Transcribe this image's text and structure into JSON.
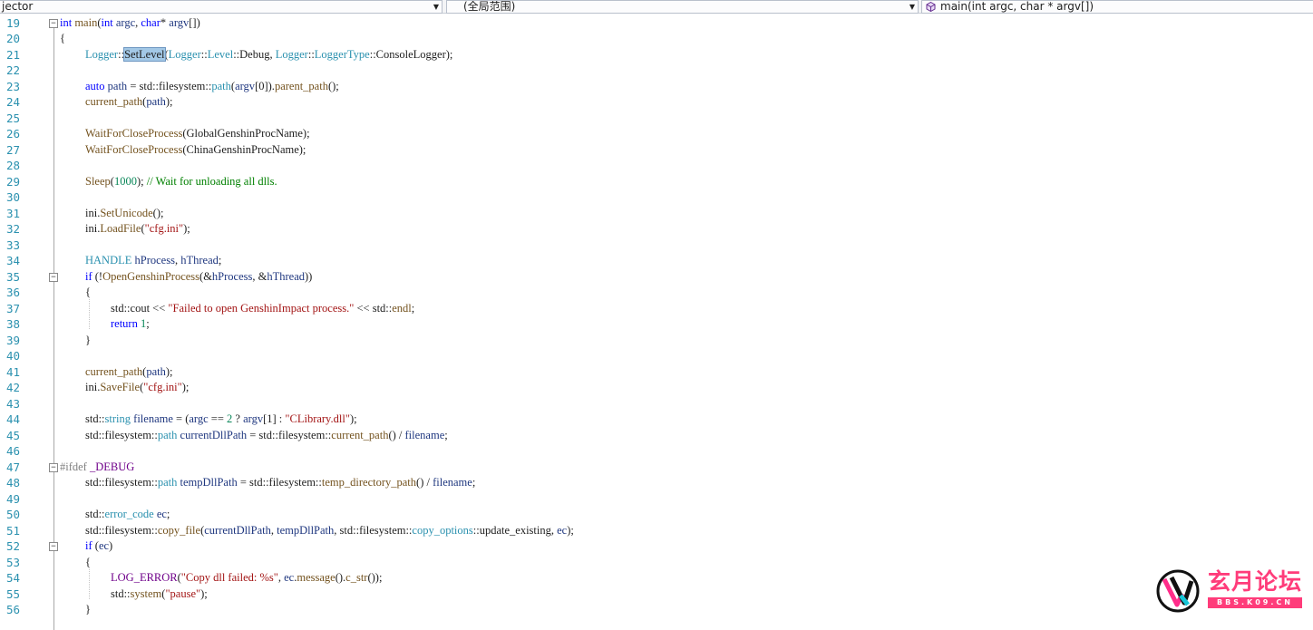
{
  "navbar": {
    "project": "jector",
    "scope": "(全局范围)",
    "member": "main(int argc, char * argv[])"
  },
  "editor": {
    "lines": [
      {
        "n": "19",
        "fold": "minus",
        "indent": 0,
        "toks": [
          [
            "kw",
            "int"
          ],
          [
            "p",
            " "
          ],
          [
            "fn",
            "main"
          ],
          [
            "p",
            "("
          ],
          [
            "kw",
            "int"
          ],
          [
            "p",
            " "
          ],
          [
            "var",
            "argc"
          ],
          [
            "p",
            ", "
          ],
          [
            "kw",
            "char"
          ],
          [
            "p",
            "* "
          ],
          [
            "var",
            "argv"
          ],
          [
            "p",
            "[])"
          ]
        ]
      },
      {
        "n": "20",
        "indent": 0,
        "toks": [
          [
            "p",
            "{"
          ]
        ]
      },
      {
        "n": "21",
        "indent": 1,
        "toks": [
          [
            "type",
            "Logger"
          ],
          [
            "p",
            "::"
          ],
          [
            "hl",
            "SetLevel"
          ],
          [
            "p",
            "("
          ],
          [
            "type",
            "Logger"
          ],
          [
            "p",
            "::"
          ],
          [
            "type",
            "Level"
          ],
          [
            "p",
            "::Debug, "
          ],
          [
            "type",
            "Logger"
          ],
          [
            "p",
            "::"
          ],
          [
            "type",
            "LoggerType"
          ],
          [
            "p",
            "::ConsoleLogger);"
          ]
        ]
      },
      {
        "n": "22",
        "indent": 1,
        "toks": []
      },
      {
        "n": "23",
        "indent": 1,
        "toks": [
          [
            "kw",
            "auto"
          ],
          [
            "p",
            " "
          ],
          [
            "var",
            "path"
          ],
          [
            "p",
            " = std::filesystem::"
          ],
          [
            "type",
            "path"
          ],
          [
            "p",
            "("
          ],
          [
            "var",
            "argv"
          ],
          [
            "p",
            "[0])."
          ],
          [
            "fn",
            "parent_path"
          ],
          [
            "p",
            "();"
          ]
        ]
      },
      {
        "n": "24",
        "indent": 1,
        "toks": [
          [
            "fn",
            "current_path"
          ],
          [
            "p",
            "("
          ],
          [
            "var",
            "path"
          ],
          [
            "p",
            ");"
          ]
        ]
      },
      {
        "n": "25",
        "indent": 1,
        "toks": []
      },
      {
        "n": "26",
        "indent": 1,
        "toks": [
          [
            "fn",
            "WaitForCloseProcess"
          ],
          [
            "p",
            "(GlobalGenshinProcName);"
          ]
        ]
      },
      {
        "n": "27",
        "indent": 1,
        "toks": [
          [
            "fn",
            "WaitForCloseProcess"
          ],
          [
            "p",
            "(ChinaGenshinProcName);"
          ]
        ]
      },
      {
        "n": "28",
        "indent": 1,
        "toks": []
      },
      {
        "n": "29",
        "indent": 1,
        "toks": [
          [
            "fn",
            "Sleep"
          ],
          [
            "p",
            "("
          ],
          [
            "num",
            "1000"
          ],
          [
            "p",
            ");"
          ],
          [
            "cmt",
            " // Wait for unloading all dlls."
          ]
        ]
      },
      {
        "n": "30",
        "indent": 1,
        "toks": []
      },
      {
        "n": "31",
        "indent": 1,
        "toks": [
          [
            "p",
            "ini."
          ],
          [
            "fn",
            "SetUnicode"
          ],
          [
            "p",
            "();"
          ]
        ]
      },
      {
        "n": "32",
        "indent": 1,
        "toks": [
          [
            "p",
            "ini."
          ],
          [
            "fn",
            "LoadFile"
          ],
          [
            "p",
            "("
          ],
          [
            "str",
            "\"cfg.ini\""
          ],
          [
            "p",
            ");"
          ]
        ]
      },
      {
        "n": "33",
        "indent": 1,
        "toks": []
      },
      {
        "n": "34",
        "indent": 1,
        "toks": [
          [
            "type",
            "HANDLE"
          ],
          [
            "p",
            " "
          ],
          [
            "var",
            "hProcess"
          ],
          [
            "p",
            ", "
          ],
          [
            "var",
            "hThread"
          ],
          [
            "p",
            ";"
          ]
        ]
      },
      {
        "n": "35",
        "fold": "minus",
        "indent": 1,
        "toks": [
          [
            "kw",
            "if"
          ],
          [
            "p",
            " (!"
          ],
          [
            "fn",
            "OpenGenshinProcess"
          ],
          [
            "p",
            "(&"
          ],
          [
            "var",
            "hProcess"
          ],
          [
            "p",
            ", &"
          ],
          [
            "var",
            "hThread"
          ],
          [
            "p",
            "))"
          ]
        ]
      },
      {
        "n": "36",
        "indent": 1,
        "toks": [
          [
            "p",
            "{"
          ]
        ]
      },
      {
        "n": "37",
        "indent": 2,
        "toks": [
          [
            "p",
            "std::cout << "
          ],
          [
            "str",
            "\"Failed to open GenshinImpact process.\""
          ],
          [
            "p",
            " << std::"
          ],
          [
            "fn",
            "endl"
          ],
          [
            "p",
            ";"
          ]
        ]
      },
      {
        "n": "38",
        "indent": 2,
        "toks": [
          [
            "kw",
            "return"
          ],
          [
            "p",
            " "
          ],
          [
            "num",
            "1"
          ],
          [
            "p",
            ";"
          ]
        ]
      },
      {
        "n": "39",
        "indent": 1,
        "toks": [
          [
            "p",
            "}"
          ]
        ]
      },
      {
        "n": "40",
        "indent": 1,
        "toks": []
      },
      {
        "n": "41",
        "indent": 1,
        "toks": [
          [
            "fn",
            "current_path"
          ],
          [
            "p",
            "("
          ],
          [
            "var",
            "path"
          ],
          [
            "p",
            ");"
          ]
        ]
      },
      {
        "n": "42",
        "indent": 1,
        "toks": [
          [
            "p",
            "ini."
          ],
          [
            "fn",
            "SaveFile"
          ],
          [
            "p",
            "("
          ],
          [
            "str",
            "\"cfg.ini\""
          ],
          [
            "p",
            ");"
          ]
        ]
      },
      {
        "n": "43",
        "indent": 1,
        "toks": []
      },
      {
        "n": "44",
        "indent": 1,
        "toks": [
          [
            "p",
            "std::"
          ],
          [
            "type",
            "string"
          ],
          [
            "p",
            " "
          ],
          [
            "var",
            "filename"
          ],
          [
            "p",
            " = ("
          ],
          [
            "var",
            "argc"
          ],
          [
            "p",
            " == "
          ],
          [
            "num",
            "2"
          ],
          [
            "p",
            " ? "
          ],
          [
            "var",
            "argv"
          ],
          [
            "p",
            "[1] : "
          ],
          [
            "str",
            "\"CLibrary.dll\""
          ],
          [
            "p",
            ");"
          ]
        ]
      },
      {
        "n": "45",
        "indent": 1,
        "toks": [
          [
            "p",
            "std::filesystem::"
          ],
          [
            "type",
            "path"
          ],
          [
            "p",
            " "
          ],
          [
            "var",
            "currentDllPath"
          ],
          [
            "p",
            " = std::filesystem::"
          ],
          [
            "fn",
            "current_path"
          ],
          [
            "p",
            "() / "
          ],
          [
            "var",
            "filename"
          ],
          [
            "p",
            ";"
          ]
        ]
      },
      {
        "n": "46",
        "indent": 1,
        "toks": []
      },
      {
        "n": "47",
        "fold": "minus",
        "indent": 0,
        "toks": [
          [
            "pp",
            "#ifdef "
          ],
          [
            "mac",
            "_DEBUG"
          ]
        ]
      },
      {
        "n": "48",
        "indent": 1,
        "toks": [
          [
            "p",
            "std::filesystem::"
          ],
          [
            "type",
            "path"
          ],
          [
            "p",
            " "
          ],
          [
            "var",
            "tempDllPath"
          ],
          [
            "p",
            " = std::filesystem::"
          ],
          [
            "fn",
            "temp_directory_path"
          ],
          [
            "p",
            "() / "
          ],
          [
            "var",
            "filename"
          ],
          [
            "p",
            ";"
          ]
        ]
      },
      {
        "n": "49",
        "indent": 1,
        "toks": []
      },
      {
        "n": "50",
        "indent": 1,
        "toks": [
          [
            "p",
            "std::"
          ],
          [
            "type",
            "error_code"
          ],
          [
            "p",
            " "
          ],
          [
            "var",
            "ec"
          ],
          [
            "p",
            ";"
          ]
        ]
      },
      {
        "n": "51",
        "indent": 1,
        "toks": [
          [
            "p",
            "std::filesystem::"
          ],
          [
            "fn",
            "copy_file"
          ],
          [
            "p",
            "("
          ],
          [
            "var",
            "currentDllPath"
          ],
          [
            "p",
            ", "
          ],
          [
            "var",
            "tempDllPath"
          ],
          [
            "p",
            ", std::filesystem::"
          ],
          [
            "type",
            "copy_options"
          ],
          [
            "p",
            "::update_existing, "
          ],
          [
            "var",
            "ec"
          ],
          [
            "p",
            ");"
          ]
        ]
      },
      {
        "n": "52",
        "fold": "minus",
        "indent": 1,
        "toks": [
          [
            "kw",
            "if"
          ],
          [
            "p",
            " ("
          ],
          [
            "var",
            "ec"
          ],
          [
            "p",
            ")"
          ]
        ]
      },
      {
        "n": "53",
        "indent": 1,
        "toks": [
          [
            "p",
            "{"
          ]
        ]
      },
      {
        "n": "54",
        "indent": 2,
        "toks": [
          [
            "mac",
            "LOG_ERROR"
          ],
          [
            "p",
            "("
          ],
          [
            "str",
            "\"Copy dll failed: %s\""
          ],
          [
            "p",
            ", "
          ],
          [
            "var",
            "ec"
          ],
          [
            "p",
            "."
          ],
          [
            "fn",
            "message"
          ],
          [
            "p",
            "()."
          ],
          [
            "fn",
            "c_str"
          ],
          [
            "p",
            "());"
          ]
        ]
      },
      {
        "n": "55",
        "indent": 2,
        "toks": [
          [
            "p",
            "std::"
          ],
          [
            "fn",
            "system"
          ],
          [
            "p",
            "("
          ],
          [
            "str",
            "\"pause\""
          ],
          [
            "p",
            ");"
          ]
        ]
      },
      {
        "n": "56",
        "indent": 1,
        "toks": [
          [
            "p",
            "}"
          ]
        ]
      }
    ]
  },
  "watermark": {
    "title": "玄月论坛",
    "subtitle": "BBS.K09.CN"
  }
}
